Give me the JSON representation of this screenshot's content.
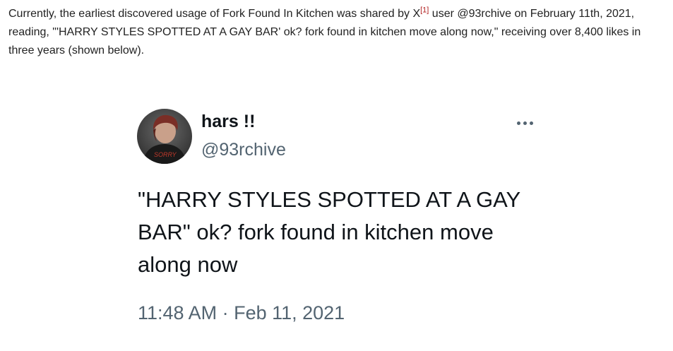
{
  "article": {
    "text_before_citation": "Currently, the earliest discovered usage of Fork Found In Kitchen was shared by X",
    "citation": "[1]",
    "text_after_citation": " user @93rchive on February 11th, 2021, reading, \"'HARRY STYLES SPOTTED AT A GAY BAR' ok? fork found in kitchen move along now,\" receiving over 8,400 likes in three years (shown below)."
  },
  "tweet": {
    "display_name": "hars !!",
    "handle": "@93rchive",
    "body_line1": "\"HARRY STYLES SPOTTED AT A GAY",
    "body_line2": "BAR\" ok? fork found in kitchen move",
    "body_line3": "along now",
    "time": "11:48 AM",
    "separator": " · ",
    "date": "Feb 11, 2021",
    "avatar_caption": "SORRY"
  },
  "colors": {
    "name": "#0f1419",
    "secondary": "#536471",
    "citation": "#b22222"
  },
  "icons": {
    "more": "more-options-icon"
  }
}
